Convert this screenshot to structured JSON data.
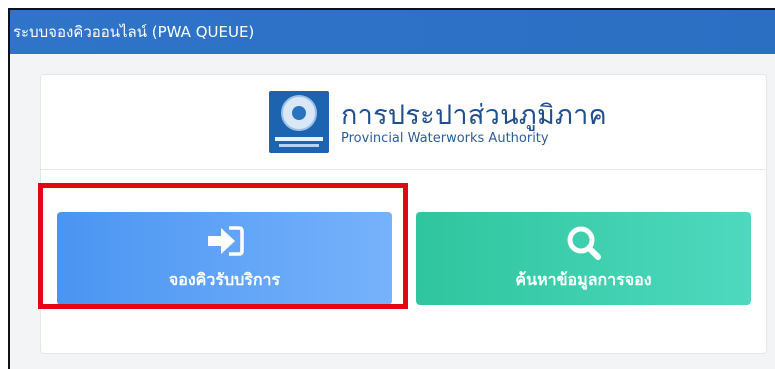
{
  "window": {
    "title": "ระบบจองคิวออนไลน์ (PWA QUEUE)"
  },
  "org": {
    "name_th": "การประปาส่วนภูมิภาค",
    "name_en": "Provincial Waterworks Authority",
    "logo_icon": "pwa-logo"
  },
  "actions": {
    "book": {
      "label": "จองคิวรับบริการ",
      "icon": "sign-in-icon",
      "color": "#4a95f2"
    },
    "search": {
      "label": "ค้นหาข้อมูลการจอง",
      "icon": "search-icon",
      "color": "#2fc59e"
    }
  },
  "annotation": {
    "highlight_color": "#e30613"
  }
}
